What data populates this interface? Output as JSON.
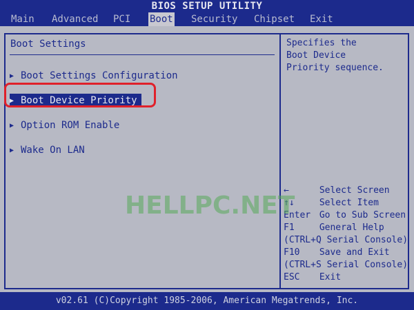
{
  "title": "BIOS SETUP UTILITY",
  "menu": [
    {
      "label": "Main",
      "active": false
    },
    {
      "label": "Advanced",
      "active": false
    },
    {
      "label": "PCI",
      "active": false
    },
    {
      "label": "Boot",
      "active": true
    },
    {
      "label": "Security",
      "active": false
    },
    {
      "label": "Chipset",
      "active": false
    },
    {
      "label": "Exit",
      "active": false
    }
  ],
  "boot": {
    "section_title": "Boot Settings",
    "items": [
      {
        "label": "Boot Settings Configuration"
      },
      {
        "label": "Boot Device Priority"
      },
      {
        "label": "Option ROM Enable"
      },
      {
        "label": "Wake On LAN"
      }
    ]
  },
  "help": {
    "description": "Specifies the\nBoot Device\nPriority sequence.",
    "keys": [
      {
        "key": "←",
        "action": "Select Screen"
      },
      {
        "key": "↑↓",
        "action": "Select Item"
      },
      {
        "key": "Enter",
        "action": "Go to Sub Screen"
      },
      {
        "key": "F1",
        "action": "General Help"
      },
      {
        "key": "(CTRL+Q",
        "action": "Serial Console)"
      },
      {
        "key": "F10",
        "action": "Save and Exit"
      },
      {
        "key": "(CTRL+S",
        "action": "Serial Console)"
      },
      {
        "key": "ESC",
        "action": "Exit"
      }
    ]
  },
  "watermark": "HELLPC.NET",
  "footer": "v02.61 (C)Copyright 1985-2006, American Megatrends, Inc.",
  "colors": {
    "background": "#1c2a8c",
    "panel": "#b7b9c4",
    "highlight_box": "#e0202a",
    "watermark": "#58aa5a"
  }
}
